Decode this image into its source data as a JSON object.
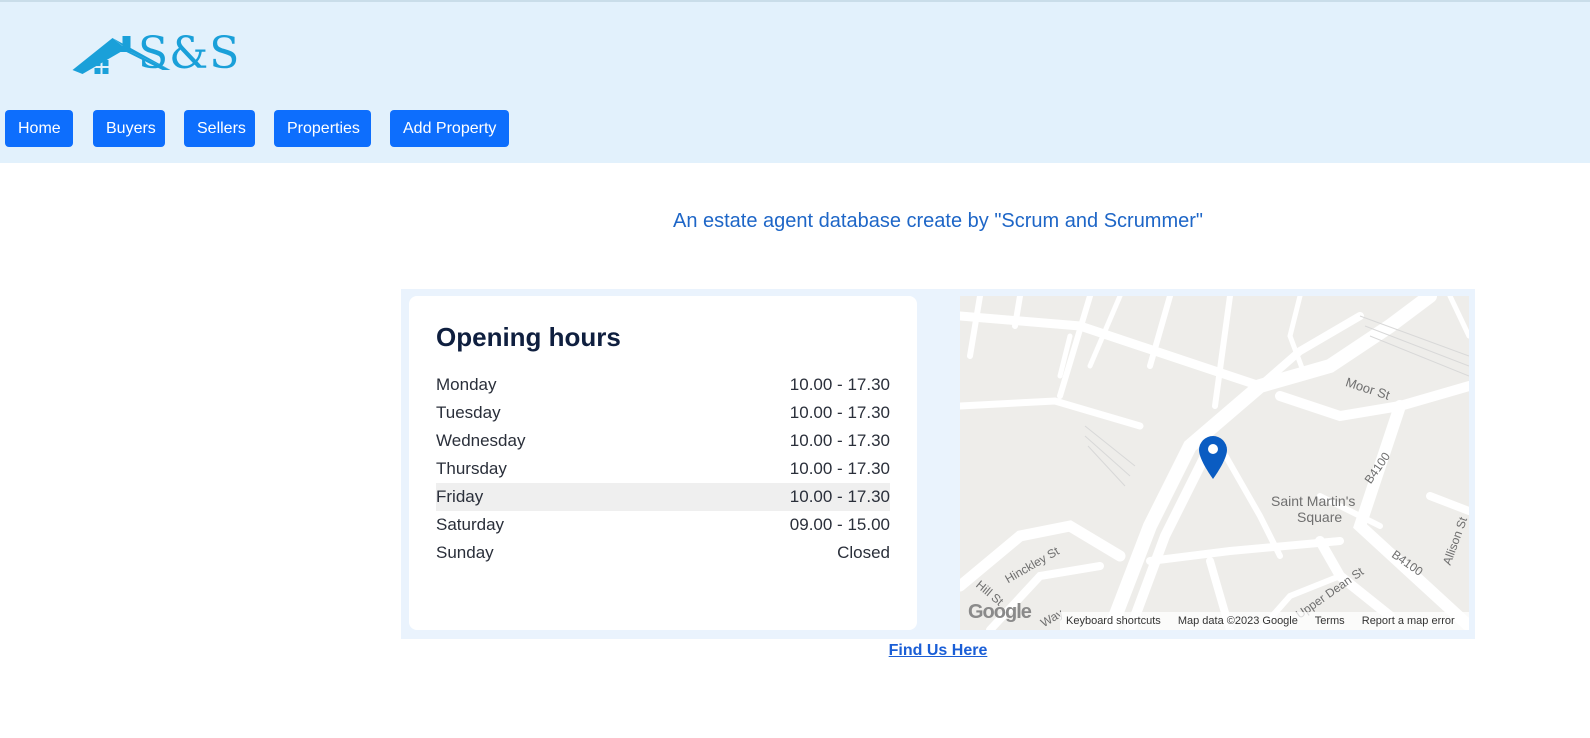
{
  "brand": {
    "name": "S&S",
    "logo_icon": "house-icon",
    "color": "#1aa0d9"
  },
  "nav": {
    "items": [
      {
        "label": "Home"
      },
      {
        "label": "Buyers"
      },
      {
        "label": "Sellers"
      },
      {
        "label": "Properties"
      },
      {
        "label": "Add Property"
      }
    ],
    "color": "#0d6efd"
  },
  "tagline": "An estate agent database create by \"Scrum and Scrummer\"",
  "hours": {
    "title": "Opening hours",
    "rows": [
      {
        "day": "Monday",
        "time": "10.00 - 17.30"
      },
      {
        "day": "Tuesday",
        "time": "10.00 - 17.30"
      },
      {
        "day": "Wednesday",
        "time": "10.00 - 17.30"
      },
      {
        "day": "Thursday",
        "time": "10.00 - 17.30"
      },
      {
        "day": "Friday",
        "time": "10.00 - 17.30"
      },
      {
        "day": "Saturday",
        "time": "09.00 - 15.00"
      },
      {
        "day": "Sunday",
        "time": "Closed"
      }
    ]
  },
  "map": {
    "labels": {
      "moor": "Moor St",
      "square1": "Saint Martin's",
      "square2": "Square",
      "b4100a": "B4100",
      "b4100b": "B4100",
      "allison": "Allison St",
      "hinckley": "Hinckley St",
      "hill": "Hill St",
      "dean": "Upper Dean St",
      "way": "Way"
    },
    "google": "Google",
    "footer": {
      "shortcuts": "Keyboard shortcuts",
      "data": "Map data ©2023 Google",
      "terms": "Terms",
      "report": "Report a map error"
    },
    "marker_icon": "map-pin-icon"
  },
  "find_us": "Find Us Here"
}
